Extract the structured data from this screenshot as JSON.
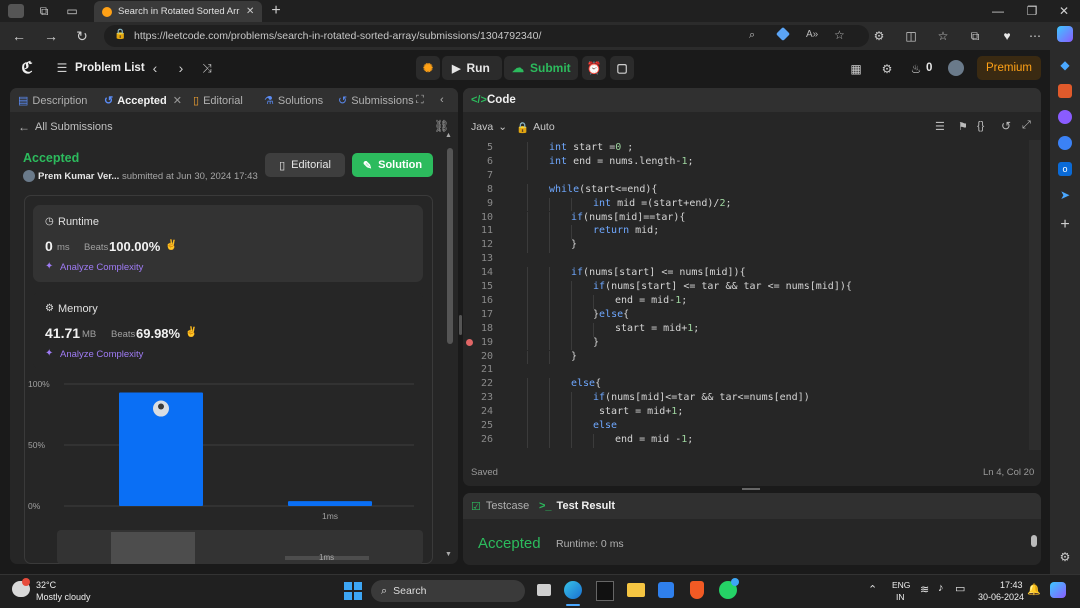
{
  "browser": {
    "tab_title": "Search in Rotated Sorted Array -",
    "url": "https://leetcode.com/problems/search-in-rotated-sorted-array/submissions/1304792340/"
  },
  "nav": {
    "problem_list": "Problem List",
    "run": "Run",
    "submit": "Submit",
    "streak": "0",
    "premium": "Premium"
  },
  "left_tabs": {
    "description": "Description",
    "accepted": "Accepted",
    "editorial": "Editorial",
    "solutions": "Solutions",
    "submissions": "Submissions"
  },
  "submission": {
    "all_submissions": "All Submissions",
    "status": "Accepted",
    "user": "Prem Kumar Ver...",
    "submitted_at": "submitted at Jun 30, 2024 17:43",
    "editorial_btn": "Editorial",
    "solution_btn": "Solution"
  },
  "runtime": {
    "label": "Runtime",
    "value": "0",
    "unit": "ms",
    "beats_label": "Beats",
    "beats": "100.00%",
    "analyze": "Analyze Complexity"
  },
  "memory": {
    "label": "Memory",
    "value": "41.71",
    "unit": "MB",
    "beats_label": "Beats",
    "beats": "69.98%",
    "analyze": "Analyze Complexity"
  },
  "chart_data": {
    "type": "bar",
    "categories": [
      "",
      "1ms"
    ],
    "values": [
      93,
      4
    ],
    "yticks": [
      "100%",
      "50%",
      "0%"
    ],
    "ylim": [
      0,
      100
    ],
    "highlight_color": "#0a6ff5",
    "lower_label": "1ms"
  },
  "code_panel": {
    "title": "Code",
    "language": "Java",
    "mode": "Auto",
    "saved": "Saved",
    "position": "Ln 4, Col 20",
    "lines": [
      {
        "n": "5",
        "indent": 2,
        "text": "int start =0 ;"
      },
      {
        "n": "6",
        "indent": 2,
        "text": "int end = nums.length-1;"
      },
      {
        "n": "7",
        "indent": 0,
        "text": ""
      },
      {
        "n": "8",
        "indent": 2,
        "text": "while(start<=end){"
      },
      {
        "n": "9",
        "indent": 4,
        "text": "int mid =(start+end)/2;"
      },
      {
        "n": "10",
        "indent": 3,
        "text": "if(nums[mid]==tar){"
      },
      {
        "n": "11",
        "indent": 4,
        "text": "return mid;"
      },
      {
        "n": "12",
        "indent": 3,
        "text": "}"
      },
      {
        "n": "13",
        "indent": 0,
        "text": ""
      },
      {
        "n": "14",
        "indent": 3,
        "text": "if(nums[start] <= nums[mid]){"
      },
      {
        "n": "15",
        "indent": 4,
        "text": "if(nums[start] <= tar && tar <= nums[mid]){"
      },
      {
        "n": "16",
        "indent": 5,
        "text": "end = mid-1;"
      },
      {
        "n": "17",
        "indent": 4,
        "text": "}else{"
      },
      {
        "n": "18",
        "indent": 5,
        "text": "start = mid+1;"
      },
      {
        "n": "19",
        "indent": 4,
        "text": "}"
      },
      {
        "n": "20",
        "indent": 3,
        "text": "}"
      },
      {
        "n": "21",
        "indent": 0,
        "text": ""
      },
      {
        "n": "22",
        "indent": 3,
        "text": "else{"
      },
      {
        "n": "23",
        "indent": 4,
        "text": "if(nums[mid]<=tar && tar<=nums[end])"
      },
      {
        "n": "24",
        "indent": 4,
        "text": " start = mid+1;"
      },
      {
        "n": "25",
        "indent": 4,
        "text": "else"
      },
      {
        "n": "26",
        "indent": 5,
        "text": "end = mid -1;"
      }
    ]
  },
  "result_panel": {
    "testcase": "Testcase",
    "test_result": "Test Result",
    "status": "Accepted",
    "runtime": "Runtime: 0 ms"
  },
  "taskbar": {
    "temp": "32°C",
    "weather": "Mostly cloudy",
    "search": "Search",
    "lang1": "ENG",
    "lang2": "IN",
    "time": "17:43",
    "date": "30-06-2024"
  },
  "colors": {
    "accepted": "#2cbb5d",
    "solution_btn": "#2cbb5d",
    "premium": "#ffa116",
    "link_purple": "#9f7bf5"
  }
}
